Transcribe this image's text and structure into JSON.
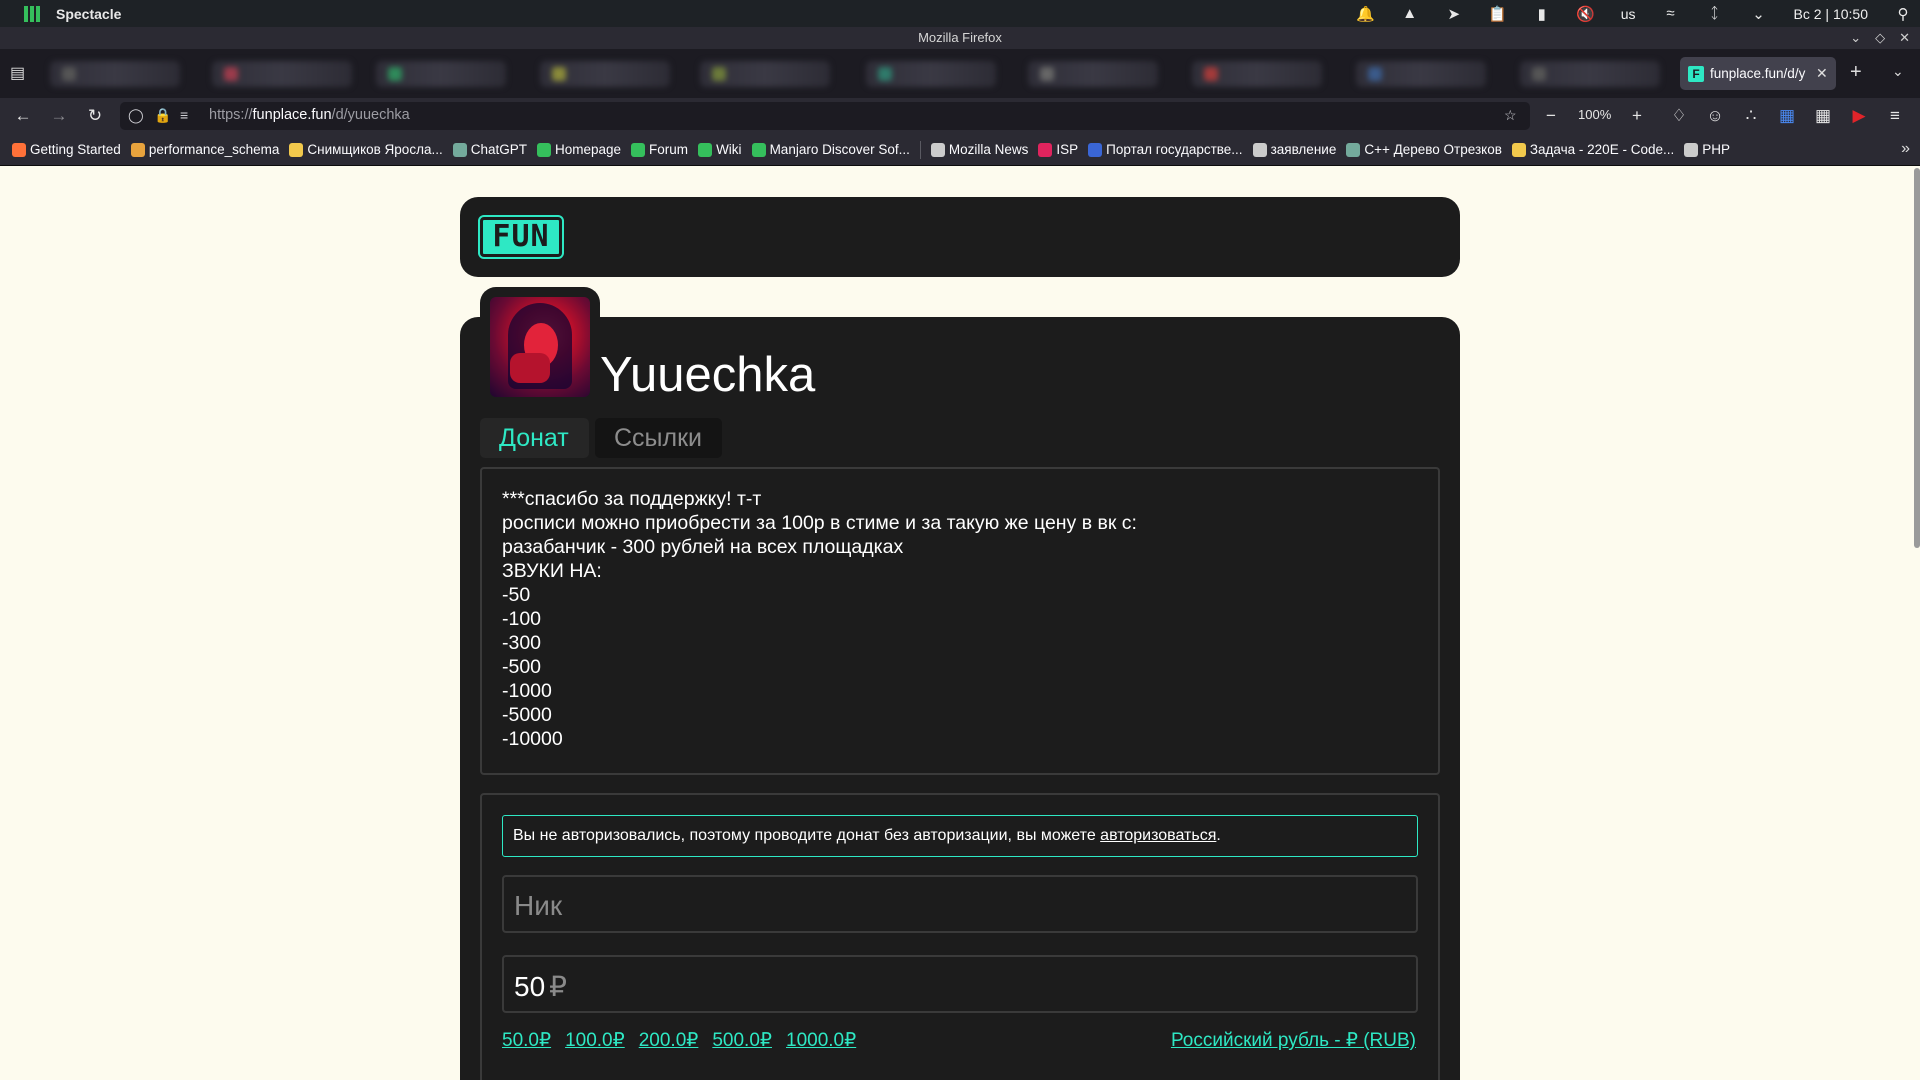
{
  "system_bar": {
    "app_name": "Spectacle",
    "keyboard_layout": "us",
    "clock": "Вс 2 | 10:50"
  },
  "window": {
    "title": "Mozilla Firefox"
  },
  "tabs": {
    "active": {
      "title": "funplace.fun/d/y",
      "favicon_letter": "F"
    }
  },
  "navbar": {
    "url_prefix": "https://",
    "url_domain": "funplace.fun",
    "url_path": "/d/yuuechka",
    "zoom": "100%"
  },
  "bookmarks": [
    {
      "label": "Getting Started",
      "color": "#ff7139"
    },
    {
      "label": "performance_schema",
      "color": "#e8a33d"
    },
    {
      "label": "Снимщиков Яросла...",
      "color": "#f2c94c"
    },
    {
      "label": "ChatGPT",
      "color": "#74aa9c"
    },
    {
      "label": "Homepage",
      "color": "#35bf5c"
    },
    {
      "label": "Forum",
      "color": "#35bf5c"
    },
    {
      "label": "Wiki",
      "color": "#35bf5c"
    },
    {
      "label": "Manjaro Discover Sof...",
      "color": "#35bf5c"
    },
    {
      "label": "Mozilla News",
      "color": "#cccccc"
    },
    {
      "label": "ISP",
      "color": "#e0245e"
    },
    {
      "label": "Портал государстве...",
      "color": "#3a66d6"
    },
    {
      "label": "заявление",
      "color": "#cccccc"
    },
    {
      "label": "C++ Дерево Отрезков",
      "color": "#74aa9c"
    },
    {
      "label": "Задача - 220E - Code...",
      "color": "#f2c94c"
    },
    {
      "label": "PHP",
      "color": "#cccccc"
    }
  ],
  "site": {
    "logo": "FUN",
    "accent_color": "#2ee8c4"
  },
  "profile": {
    "username": "Yuuechka",
    "tabs": [
      "Донат",
      "Ссылки"
    ],
    "description_lines": [
      "***спасибо за поддержку! т-т",
      "росписи можно приобрести за 100р в стиме и за такую же цену в вк с:",
      "разабанчик - 300 рублей на всех площадках",
      "ЗВУКИ НА:",
      "-50",
      "-100",
      "-300",
      "-500",
      "-1000",
      "-5000",
      "-10000"
    ]
  },
  "donation": {
    "notice_text": "Вы не авторизовались, поэтому проводите донат без авторизации, вы можете ",
    "notice_link": "авторизоваться",
    "notice_end": ".",
    "nick_placeholder": "Ник",
    "amount_value": "50",
    "amount_currency_sign": "₽",
    "presets": [
      "50.0₽",
      "100.0₽",
      "200.0₽",
      "500.0₽",
      "1000.0₽"
    ],
    "currency": "Российский рубль - ₽ (RUB)"
  }
}
